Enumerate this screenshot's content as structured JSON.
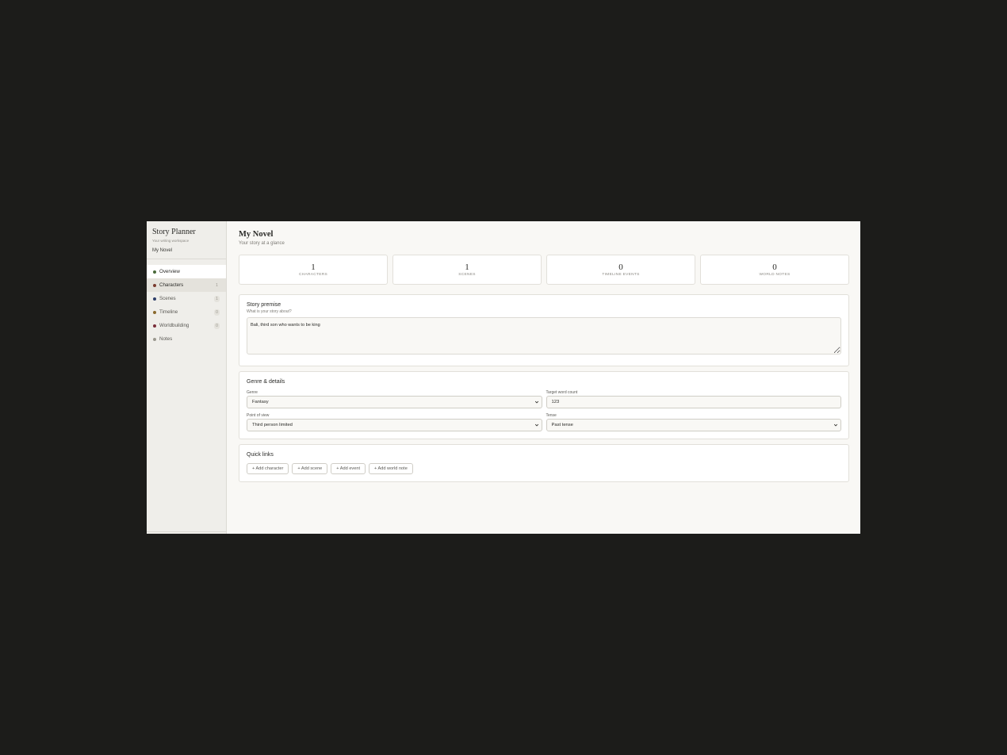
{
  "sidebar": {
    "app_title": "Story Planner",
    "app_subtitle": "Your writing workspace",
    "project_name": "My Novel",
    "items": [
      {
        "label": "Overview",
        "count": "",
        "dot_color": "#4a6a3a"
      },
      {
        "label": "Characters",
        "count": "1",
        "dot_color": "#7a3a2e"
      },
      {
        "label": "Scenes",
        "count": "1",
        "dot_color": "#2e3e6a"
      },
      {
        "label": "Timeline",
        "count": "0",
        "dot_color": "#8a6a2e"
      },
      {
        "label": "Worldbuilding",
        "count": "0",
        "dot_color": "#7a2e3a"
      },
      {
        "label": "Notes",
        "count": "",
        "dot_color": "#9a988f"
      }
    ]
  },
  "header": {
    "title": "My Novel",
    "subtitle": "Your story at a glance"
  },
  "stats": [
    {
      "value": "1",
      "label": "CHARACTERS"
    },
    {
      "value": "1",
      "label": "SCENES"
    },
    {
      "value": "0",
      "label": "TIMELINE EVENTS"
    },
    {
      "value": "0",
      "label": "WORLD NOTES"
    }
  ],
  "premise": {
    "title": "Story premise",
    "subtitle": "What is your story about?",
    "value": "Bali, third son who wants to be king"
  },
  "details": {
    "title": "Genre & details",
    "genre_label": "Genre",
    "genre_value": "Fantasy",
    "word_count_label": "Target word count",
    "word_count_value": "123",
    "pov_label": "Point of view",
    "pov_value": "Third person limited",
    "tense_label": "Tense",
    "tense_value": "Past tense"
  },
  "quick_links": {
    "title": "Quick links",
    "add_character": "+ Add character",
    "add_scene": "+ Add scene",
    "add_event": "+ Add event",
    "add_world_note": "+ Add world note"
  },
  "colors": {
    "background": "#1c1c1a",
    "app_bg": "#f9f8f5",
    "sidebar_bg": "#efeeea"
  }
}
